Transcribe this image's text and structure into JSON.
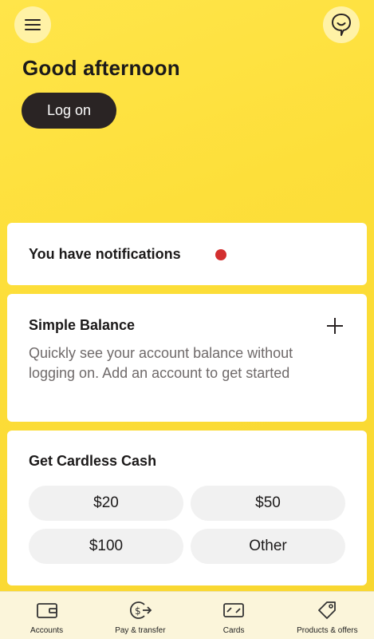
{
  "header": {
    "menu_icon": "hamburger-menu-icon",
    "chat_icon": "chat-bubble-icon",
    "greeting": "Good afternoon",
    "logon_label": "Log on"
  },
  "notifications": {
    "text": "You have notifications",
    "indicator_color": "#d32f2f"
  },
  "balance": {
    "title": "Simple Balance",
    "description": "Quickly see your account balance without logging on. Add an account to get started",
    "add_icon": "plus-icon"
  },
  "cardless_cash": {
    "title": "Get Cardless Cash",
    "amounts": [
      "$20",
      "$50",
      "$100",
      "Other"
    ]
  },
  "bottom_nav": {
    "items": [
      {
        "label": "Accounts",
        "icon": "wallet-icon"
      },
      {
        "label": "Pay & transfer",
        "icon": "pay-transfer-icon"
      },
      {
        "label": "Cards",
        "icon": "card-icon"
      },
      {
        "label": "Products & offers",
        "icon": "tag-icon"
      }
    ]
  },
  "colors": {
    "background": "#FDDF3A",
    "primary_button": "#2a2424",
    "card": "#ffffff"
  }
}
